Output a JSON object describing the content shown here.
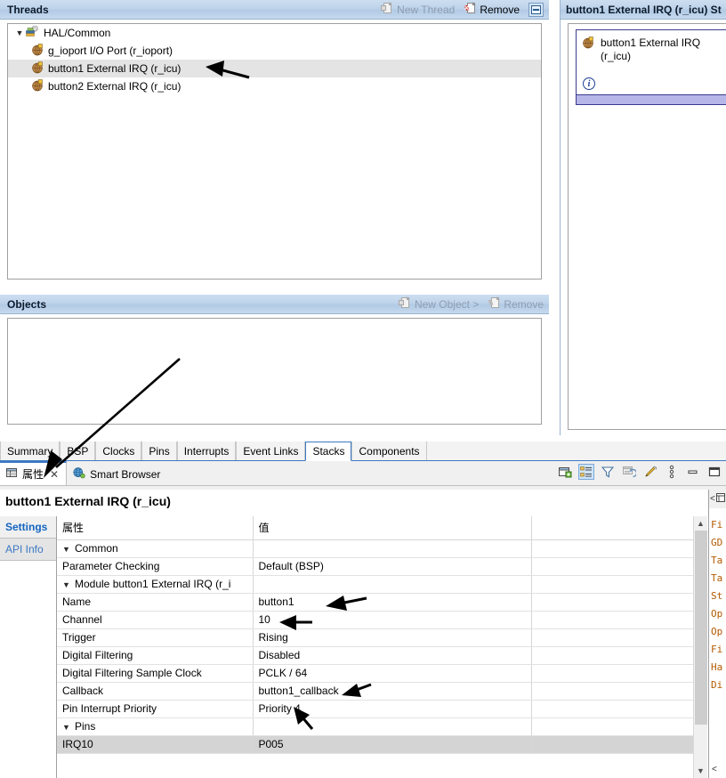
{
  "threads_panel": {
    "title": "Threads",
    "actions": [
      {
        "label": "New Thread",
        "icon": "new-thread-icon",
        "enabled": false
      },
      {
        "label": "Remove",
        "icon": "remove-icon",
        "enabled": true
      }
    ],
    "minimize_icon": "minimize-icon",
    "tree": [
      {
        "label": "HAL/Common",
        "icon": "hal-common-icon",
        "level": 0,
        "expanded": true,
        "selected": false
      },
      {
        "label": "g_ioport I/O Port (r_ioport)",
        "icon": "module-icon",
        "level": 1,
        "expanded": false,
        "selected": false
      },
      {
        "label": "button1 External IRQ (r_icu)",
        "icon": "module-icon",
        "level": 1,
        "expanded": false,
        "selected": true
      },
      {
        "label": "button2 External IRQ (r_icu)",
        "icon": "module-icon",
        "level": 1,
        "expanded": false,
        "selected": false
      }
    ]
  },
  "objects_panel": {
    "title": "Objects",
    "actions": [
      {
        "label": "New Object >",
        "icon": "new-object-icon",
        "enabled": false
      },
      {
        "label": "Remove",
        "icon": "remove-icon",
        "enabled": false
      }
    ]
  },
  "stack_panel": {
    "title": "button1 External IRQ (r_icu) St",
    "box": {
      "icon": "module-icon",
      "title": "button1 External IRQ (r_icu)",
      "info_icon": "info-icon"
    }
  },
  "config_tabs": [
    {
      "label": "Summary",
      "active": false
    },
    {
      "label": "BSP",
      "active": false
    },
    {
      "label": "Clocks",
      "active": false
    },
    {
      "label": "Pins",
      "active": false
    },
    {
      "label": "Interrupts",
      "active": false
    },
    {
      "label": "Event Links",
      "active": false
    },
    {
      "label": "Stacks",
      "active": true
    },
    {
      "label": "Components",
      "active": false
    }
  ],
  "view_tabs": [
    {
      "label": "属性",
      "icon": "properties-icon",
      "active": true,
      "closable": true
    },
    {
      "label": "Smart Browser",
      "icon": "globe-icon",
      "active": false,
      "closable": false
    }
  ],
  "view_toolbar": [
    {
      "name": "new-view-icon",
      "selected": false
    },
    {
      "name": "show-categories-icon",
      "selected": true
    },
    {
      "name": "filter-icon",
      "selected": false
    },
    {
      "name": "restore-default-icon",
      "selected": false
    },
    {
      "name": "pin-icon",
      "selected": false
    },
    {
      "name": "view-menu-icon",
      "selected": false
    },
    {
      "name": "minimize-icon",
      "selected": false
    },
    {
      "name": "maximize-icon",
      "selected": false
    }
  ],
  "properties": {
    "title": "button1 External IRQ (r_icu)",
    "side_tabs": [
      {
        "label": "Settings",
        "active": true
      },
      {
        "label": "API Info",
        "active": false
      }
    ],
    "columns": [
      "属性",
      "值"
    ],
    "rows": [
      {
        "kind": "group",
        "property": "Common",
        "value": "",
        "expanded": true,
        "selected": false
      },
      {
        "kind": "item",
        "property": "Parameter Checking",
        "value": "Default (BSP)",
        "selected": false
      },
      {
        "kind": "group",
        "property": "Module button1 External IRQ (r_i",
        "value": "",
        "expanded": true,
        "selected": false
      },
      {
        "kind": "item",
        "property": "Name",
        "value": "button1",
        "selected": false
      },
      {
        "kind": "item",
        "property": "Channel",
        "value": "10",
        "selected": false
      },
      {
        "kind": "item",
        "property": "Trigger",
        "value": "Rising",
        "selected": false
      },
      {
        "kind": "item",
        "property": "Digital Filtering",
        "value": "Disabled",
        "selected": false
      },
      {
        "kind": "item",
        "property": "Digital Filtering Sample Clock",
        "value": "PCLK / 64",
        "selected": false
      },
      {
        "kind": "item",
        "property": "Callback",
        "value": "button1_callback",
        "selected": false
      },
      {
        "kind": "item",
        "property": "Pin Interrupt Priority",
        "value": "Priority 4",
        "selected": false
      },
      {
        "kind": "group",
        "property": "Pins",
        "value": "",
        "expanded": true,
        "selected": false
      },
      {
        "kind": "item",
        "property": "IRQ10",
        "value": "P005",
        "selected": true
      }
    ]
  },
  "smart_browser": {
    "toolbar_label": "<",
    "items": [
      "Fi",
      "GD",
      "Ta",
      "Ta",
      "St",
      "Op",
      "Op",
      "Fi",
      "Ha",
      "Di"
    ],
    "bottom_label": "<"
  },
  "colors": {
    "panel_header_blue": "#bed3ea",
    "selection_gray": "#d4d4d4",
    "accent_blue": "#3b78c3",
    "tab_link_blue": "#1565c0",
    "stack_bar_lavender": "#b6b6e8",
    "module_icon_brown": "#b07a3c"
  }
}
